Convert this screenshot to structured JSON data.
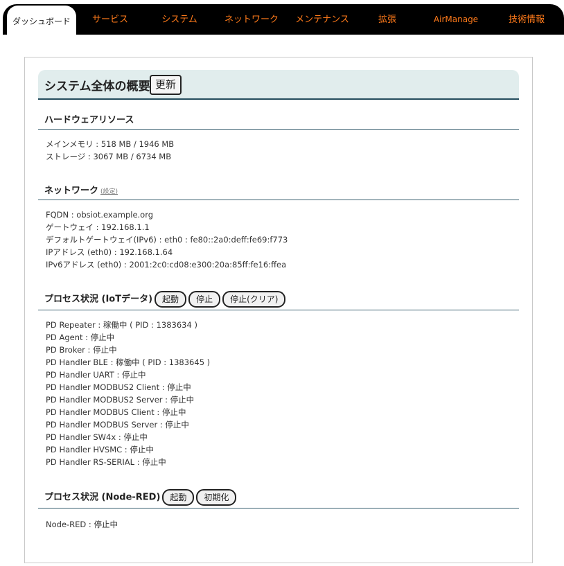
{
  "nav": {
    "tabs": [
      {
        "label": "ダッシュボード",
        "active": true
      },
      {
        "label": "サービス"
      },
      {
        "label": "システム"
      },
      {
        "label": "ネットワーク"
      },
      {
        "label": "メンテナンス"
      },
      {
        "label": "拡張"
      },
      {
        "label": "AirManage"
      },
      {
        "label": "技術情報"
      }
    ]
  },
  "overview": {
    "title": "システム全体の概要",
    "refresh_label": "更新"
  },
  "hardware": {
    "title": "ハードウェアリソース",
    "lines": [
      "メインメモリ : 518 MB / 1946 MB",
      "ストレージ : 3067 MB / 6734 MB"
    ]
  },
  "network": {
    "title": "ネットワーク",
    "settings_link": "(設定)",
    "lines": [
      "FQDN : obsiot.example.org",
      "ゲートウェイ : 192.168.1.1",
      "デフォルトゲートウェイ(IPv6) : eth0 : fe80::2a0:deff:fe69:f773",
      "IPアドレス (eth0) : 192.168.1.64",
      "IPv6アドレス (eth0) : 2001:2c0:cd08:e300:20a:85ff:fe16:ffea"
    ]
  },
  "process_iot": {
    "title": "プロセス状況 (IoTデータ)",
    "start_label": "起動",
    "stop_label": "停止",
    "stop_clear_label": "停止(クリア)",
    "lines": [
      "PD Repeater : 稼働中 ( PID : 1383634 )",
      "PD Agent : 停止中",
      "PD Broker : 停止中",
      "PD Handler BLE : 稼働中 ( PID : 1383645 )",
      "PD Handler UART : 停止中",
      "PD Handler MODBUS2 Client : 停止中",
      "PD Handler MODBUS2 Server : 停止中",
      "PD Handler MODBUS Client : 停止中",
      "PD Handler MODBUS Server : 停止中",
      "PD Handler SW4x : 停止中",
      "PD Handler HVSMC : 停止中",
      "PD Handler RS-SERIAL : 停止中"
    ]
  },
  "process_nodered": {
    "title": "プロセス状況 (Node-RED)",
    "start_label": "起動",
    "init_label": "初期化",
    "lines": [
      "Node-RED : 停止中"
    ]
  }
}
